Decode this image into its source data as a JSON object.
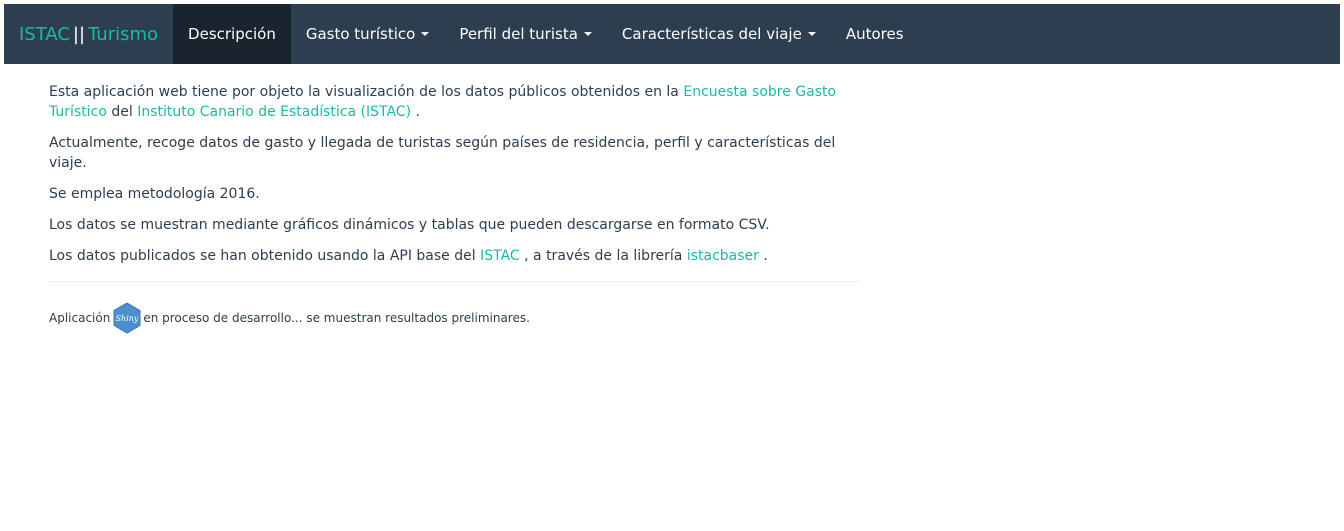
{
  "navbar": {
    "brand": {
      "left": "ISTAC",
      "sep": "||",
      "right": "Turismo"
    },
    "items": [
      {
        "label": "Descripción",
        "active": true,
        "dropdown": false
      },
      {
        "label": "Gasto turístico",
        "active": false,
        "dropdown": true
      },
      {
        "label": "Perfil del turista",
        "active": false,
        "dropdown": true
      },
      {
        "label": "Características del viaje",
        "active": false,
        "dropdown": true
      },
      {
        "label": "Autores",
        "active": false,
        "dropdown": false
      }
    ]
  },
  "content": {
    "p1": {
      "text_before": "Esta aplicación web tiene por objeto la visualización de los datos públicos obtenidos en la ",
      "link1": "Encuesta sobre Gasto Turístico",
      "text_mid": " del ",
      "link2": "Instituto Canario de Estadística (ISTAC)",
      "text_after": " ."
    },
    "p2": "Actualmente, recoge datos de gasto y llegada de turistas según países de residencia, perfil y características del viaje.",
    "p3": "Se emplea metodología 2016.",
    "p4": "Los datos se muestran mediante gráficos dinámicos y tablas que pueden descargarse en formato CSV.",
    "p5": {
      "text_before": "Los datos publicados se han obtenido usando la API base del ",
      "link1": "ISTAC",
      "text_mid": " , a través de la librería ",
      "link2": "istacbaser",
      "text_after": " ."
    },
    "footer": {
      "before": "Aplicación",
      "logo_text": "Shiny",
      "after": "en proceso de desarrollo... se muestran resultados preliminares."
    }
  },
  "colors": {
    "navbar_bg": "#2c3e50",
    "navbar_active_bg": "#1a242f",
    "accent": "#18bc9c",
    "text": "#2c3e50",
    "shiny_logo": "#4b8fd1"
  }
}
